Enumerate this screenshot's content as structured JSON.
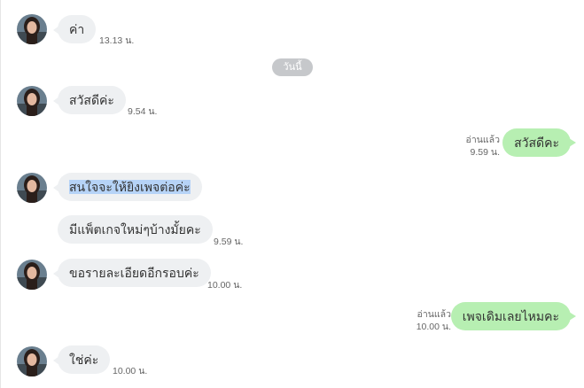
{
  "date_divider": "วันนี้",
  "messages": [
    {
      "text": "ค่า",
      "time": "13.13 น."
    },
    {
      "text": "สวัสดีค่ะ",
      "time": "9.54 น."
    },
    {
      "text": "สวัสดีคะ",
      "read": "อ่านแล้ว",
      "time": "9.59 น."
    },
    {
      "text": "สนใจจะให้ยิงเพจต่อค่ะ"
    },
    {
      "text": "มีแพ็ตเกจใหม่ๆบ้างมั้ยคะ",
      "time": "9.59 น."
    },
    {
      "text": "ขอรายละเอียดอีกรอบค่ะ",
      "time": "10.00 น."
    },
    {
      "text": "เพจเดิมเลยไหมคะ",
      "read": "อ่านแล้ว",
      "time": "10.00 น."
    },
    {
      "text": "ใช่ค่ะ",
      "time": "10.00 น."
    }
  ],
  "colors": {
    "incoming_bubble": "#eef0f2",
    "outgoing_bubble": "#b7efb2",
    "selection": "#b6d3f7"
  },
  "icons": {
    "avatar": "contact-avatar"
  }
}
